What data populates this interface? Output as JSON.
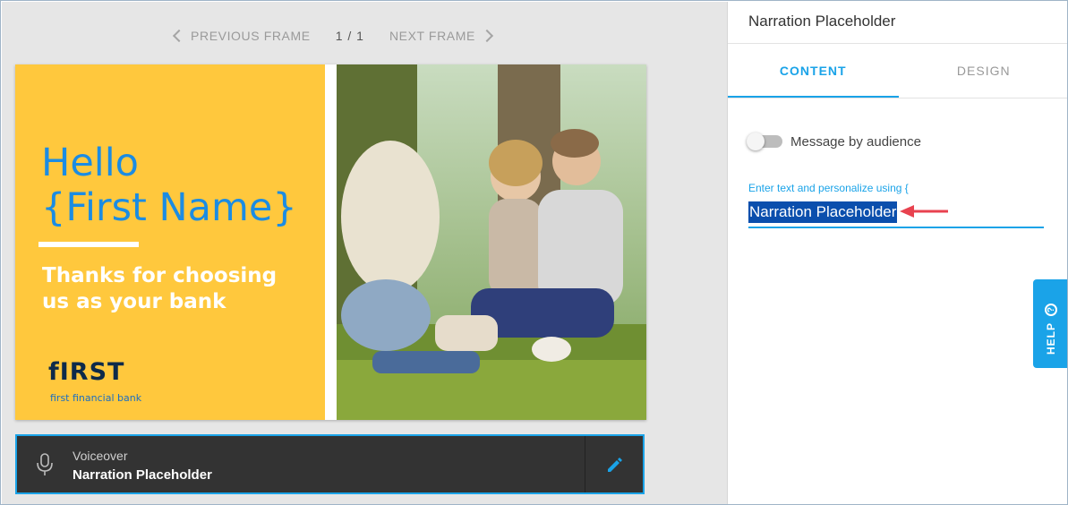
{
  "frame_nav": {
    "previous_label": "PREVIOUS FRAME",
    "counter": "1 / 1",
    "next_label": "NEXT FRAME"
  },
  "slide": {
    "hello_line1": "Hello",
    "hello_line2": "{First Name}",
    "thanks": "Thanks for choosing us as your bank",
    "logo_name": "fIRST",
    "logo_tagline": "first financial bank",
    "colors": {
      "background": "#ffc83d",
      "hello": "#1b8ce3"
    }
  },
  "voiceover": {
    "label": "Voiceover",
    "text": "Narration Placeholder",
    "mic_icon": "microphone-icon",
    "edit_icon": "pencil-icon"
  },
  "panel": {
    "title": "Narration Placeholder",
    "tabs": [
      {
        "label": "CONTENT",
        "active": true
      },
      {
        "label": "DESIGN",
        "active": false
      }
    ],
    "toggle_label": "Message by audience",
    "toggle_on": false,
    "field_label": "Enter text and personalize using {",
    "field_value": "Narration Placeholder",
    "accent": "#1aa3e8"
  },
  "help": {
    "label": "HELP",
    "icon": "question-icon"
  }
}
